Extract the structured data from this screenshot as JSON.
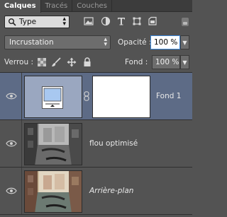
{
  "tabs": [
    "Calques",
    "Tracés",
    "Couches"
  ],
  "filter": {
    "label": "Type"
  },
  "blend_mode": "Incrustation",
  "opacity": {
    "label": "Opacité :",
    "value": "100 %"
  },
  "lock": {
    "label": "Verrou :"
  },
  "fill": {
    "label": "Fond :",
    "value": "100 %"
  },
  "layers": [
    {
      "name": "Fond 1",
      "selected": true,
      "italic": false
    },
    {
      "name": "flou optimisé",
      "selected": false,
      "italic": false
    },
    {
      "name": "Arrière-plan",
      "selected": false,
      "italic": true
    }
  ]
}
